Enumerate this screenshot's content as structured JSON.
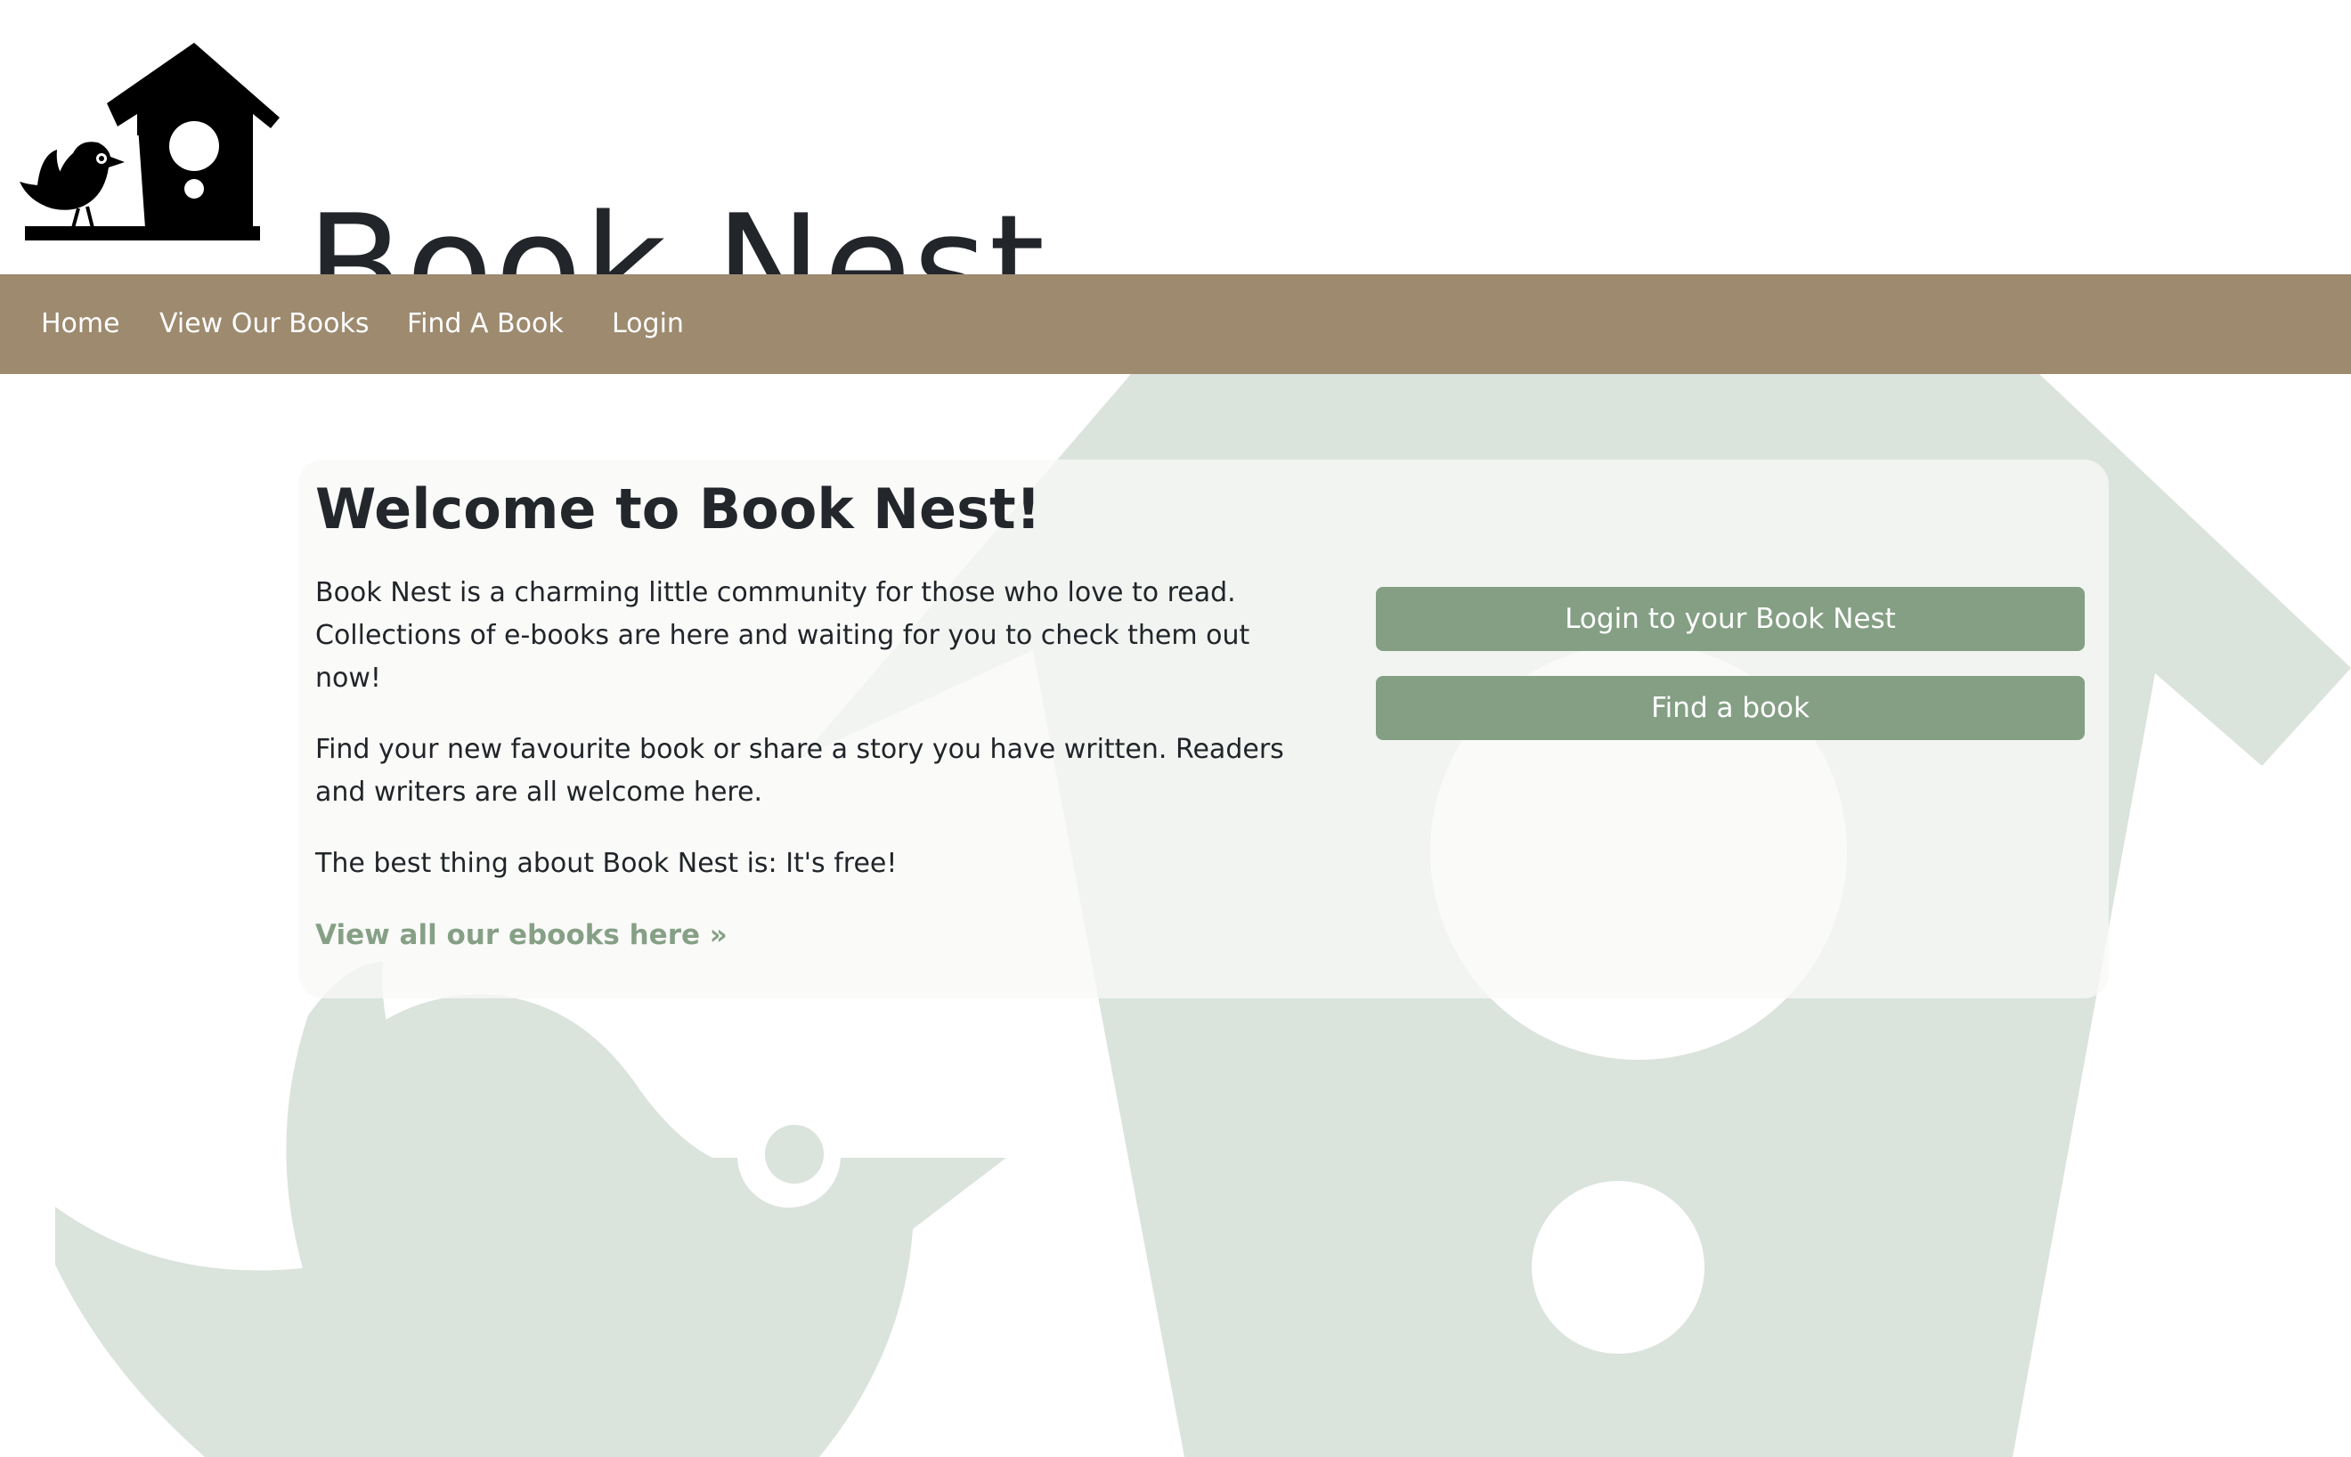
{
  "brand": {
    "title": "Book Nest",
    "logo_icon": "birdhouse-with-bird-icon"
  },
  "nav": {
    "items": [
      {
        "label": "Home"
      },
      {
        "label": "View Our Books"
      },
      {
        "label": "Find A Book"
      },
      {
        "label": "Login"
      }
    ]
  },
  "main": {
    "heading": "Welcome to Book Nest!",
    "paragraphs": [
      "Book Nest is a charming little community for those who love to read. Collections of e-books are here and waiting for you to check them out now!",
      "Find your new favourite book or share a story you have written. Readers and writers are all welcome here.",
      "The best thing about Book Nest is: It's free!"
    ],
    "ebooks_link": "View all our ebooks here »",
    "buttons": {
      "login": "Login to your Book Nest",
      "find": "Find a book"
    }
  },
  "colors": {
    "nav_background": "#9d8a6f",
    "button": "#849f84",
    "link": "#86a086",
    "background_art": "#dae3dc"
  }
}
